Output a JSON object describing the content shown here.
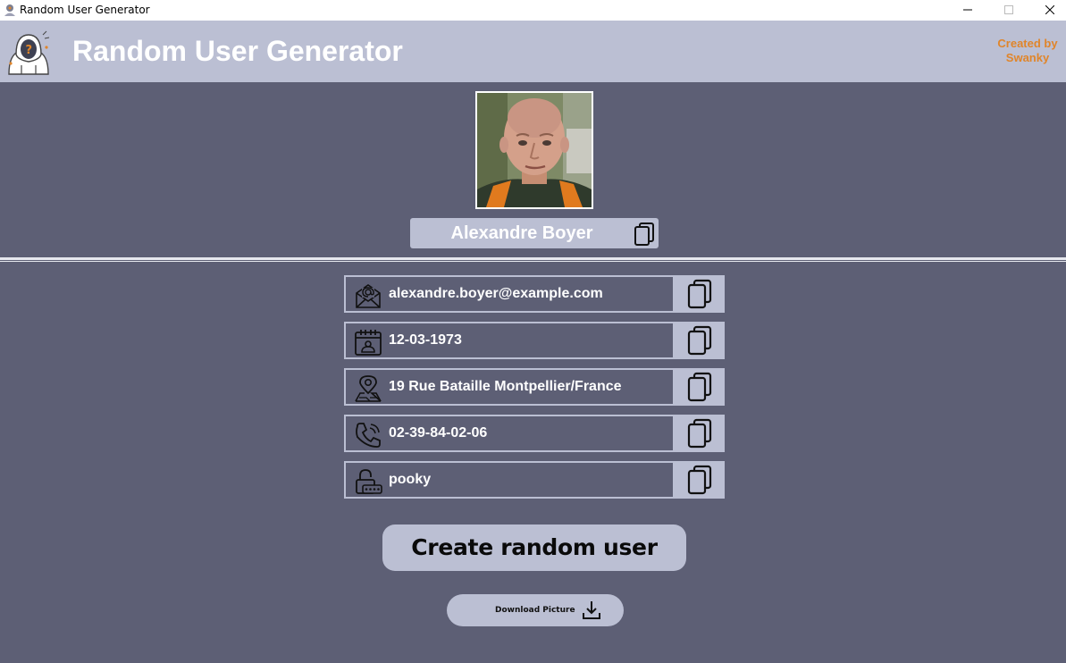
{
  "window": {
    "title": "Random User Generator",
    "controls": [
      "minimize",
      "maximize",
      "close"
    ]
  },
  "header": {
    "title": "Random User Generator",
    "credit_line1": "Created by",
    "credit_line2": "Swanky",
    "logo_icon": "hooded-anonymous-user-icon",
    "background": "#bbbfd3",
    "credit_color": "#e0852a"
  },
  "user": {
    "name": "Alexandre Boyer",
    "avatar_alt": "Portrait photo of user",
    "fields": [
      {
        "key": "email",
        "icon": "email-icon",
        "value": "alexandre.boyer@example.com"
      },
      {
        "key": "birthdate",
        "icon": "calendar-icon",
        "value": "12-03-1973"
      },
      {
        "key": "address",
        "icon": "location-pin-icon",
        "value": "19 Rue Bataille Montpellier/France"
      },
      {
        "key": "phone",
        "icon": "phone-icon",
        "value": "02-39-84-02-06"
      },
      {
        "key": "password",
        "icon": "lock-icon",
        "value": "pooky"
      }
    ]
  },
  "actions": {
    "create_label": "Create random user",
    "download_label": "Download Picture"
  },
  "theme": {
    "background": "#5d5f75",
    "accent": "#bbbfd3",
    "text": "#ffffff"
  }
}
